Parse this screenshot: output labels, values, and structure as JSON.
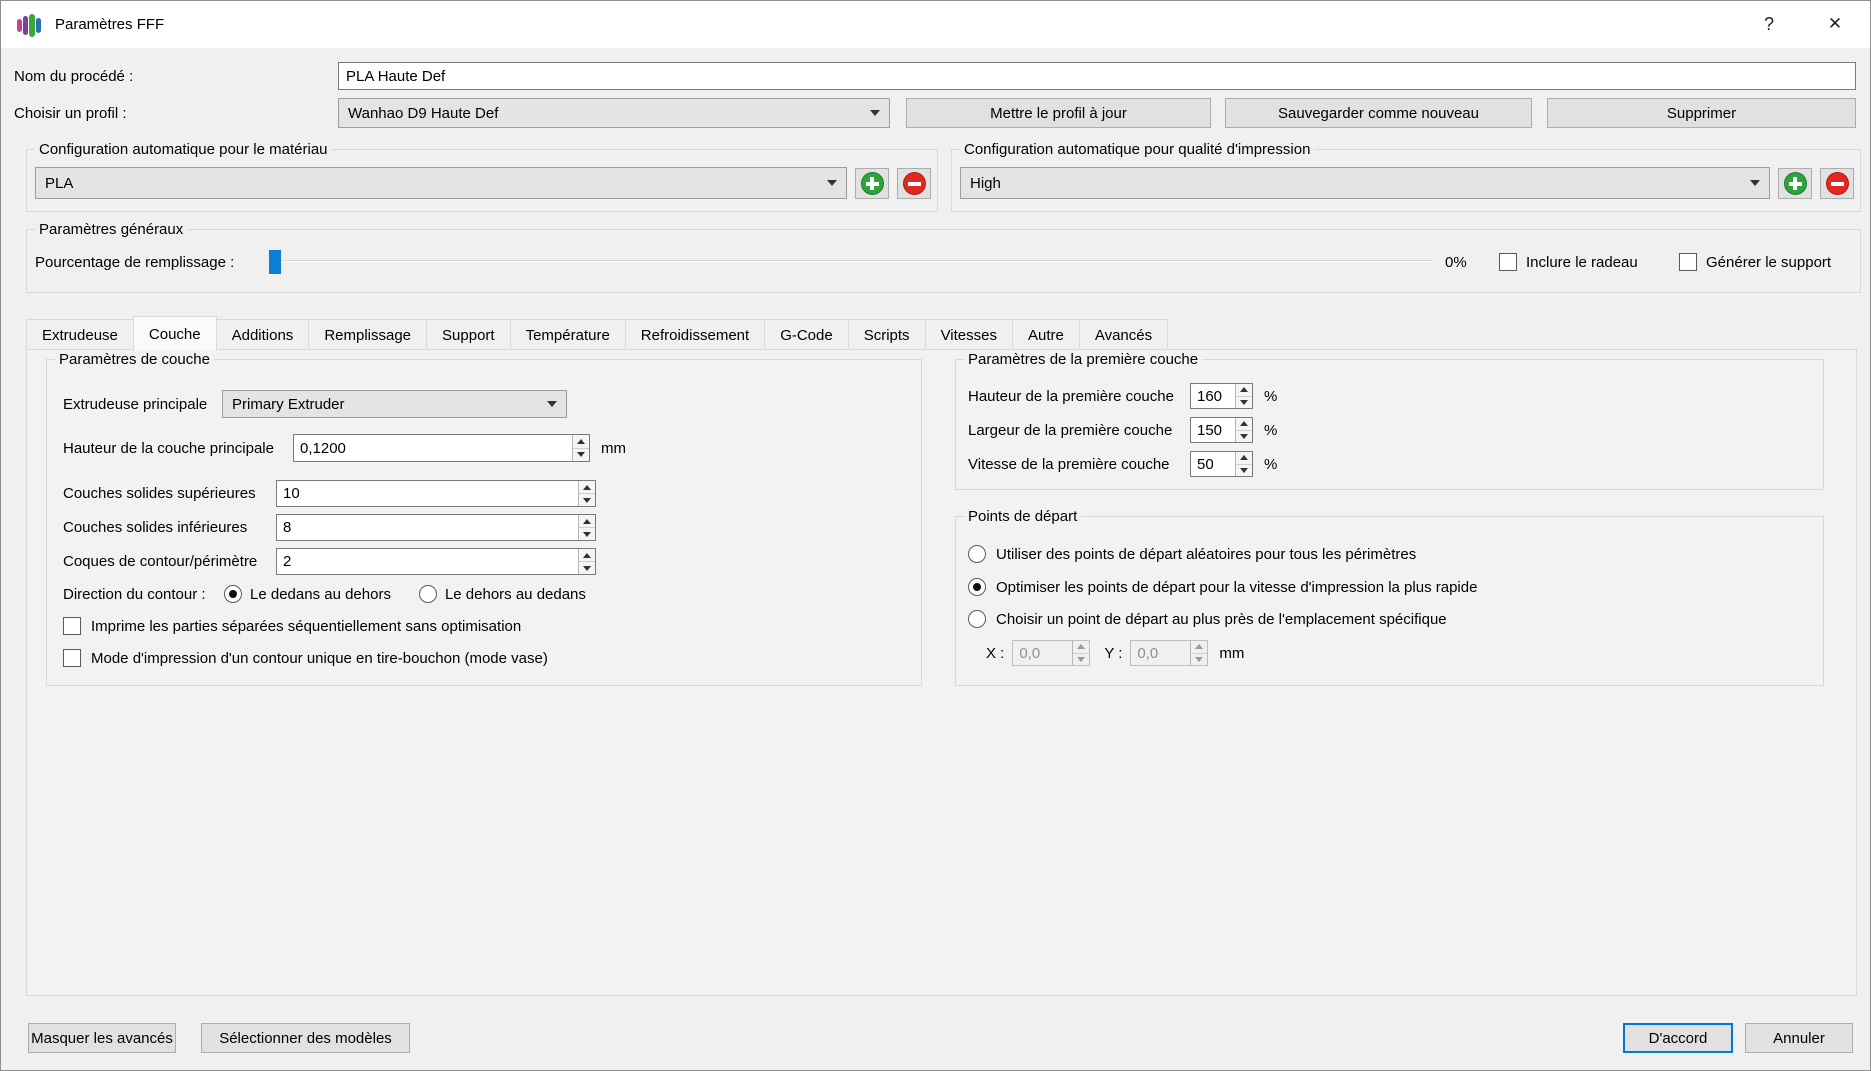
{
  "window": {
    "title": "Paramètres FFF",
    "help": "?",
    "close": "✕"
  },
  "header": {
    "process_name_label": "Nom du procédé :",
    "process_name_value": "PLA Haute Def",
    "profile_label": "Choisir un profil :",
    "profile_value": "Wanhao D9 Haute Def",
    "update_profile_button": "Mettre le profil à jour",
    "save_as_new_button": "Sauvegarder comme nouveau",
    "delete_button": "Supprimer"
  },
  "material_group": {
    "title": "Configuration automatique pour le matériau",
    "value": "PLA"
  },
  "quality_group": {
    "title": "Configuration automatique pour qualité d'impression",
    "value": "High"
  },
  "general": {
    "title": "Paramètres généraux",
    "infill_label": "Pourcentage de remplissage :",
    "infill_value": "0%",
    "raft_checkbox_label": "Inclure le radeau",
    "support_checkbox_label": "Générer le support"
  },
  "tabs": [
    "Extrudeuse",
    "Couche",
    "Additions",
    "Remplissage",
    "Support",
    "Température",
    "Refroidissement",
    "G-Code",
    "Scripts",
    "Vitesses",
    "Autre",
    "Avancés"
  ],
  "active_tab": "Couche",
  "layer": {
    "title": "Paramètres de couche",
    "primary_extruder_label": "Extrudeuse principale",
    "primary_extruder_value": "Primary Extruder",
    "layer_height_label": "Hauteur de la couche principale",
    "layer_height_value": "0,1200",
    "layer_height_unit": "mm",
    "top_layers_label": "Couches solides supérieures",
    "top_layers_value": "10",
    "bottom_layers_label": "Couches solides inférieures",
    "bottom_layers_value": "8",
    "perimeters_label": "Coques de contour/périmètre",
    "perimeters_value": "2",
    "direction_label": "Direction du contour :",
    "direction_inside_out": "Le dedans au dehors",
    "direction_outside_in": "Le dehors au dedans",
    "sequential_checkbox_label": "Imprime les parties séparées séquentiellement sans optimisation",
    "vase_checkbox_label": "Mode d'impression d'un contour unique en tire-bouchon (mode vase)"
  },
  "first_layer": {
    "title": "Paramètres de la première couche",
    "height_label": "Hauteur de la première couche",
    "height_value": "160",
    "width_label": "Largeur de la première couche",
    "width_value": "150",
    "speed_label": "Vitesse de la première couche",
    "speed_value": "50",
    "unit": "%"
  },
  "start_points": {
    "title": "Points de départ",
    "random_option": "Utiliser des points de départ aléatoires pour tous les périmètres",
    "optimize_option": "Optimiser les points de départ pour la vitesse d'impression la plus rapide",
    "closest_option": "Choisir un point de départ au plus près de l'emplacement spécifique",
    "x_label": "X :",
    "x_value": "0,0",
    "y_label": "Y :",
    "y_value": "0,0",
    "unit": "mm"
  },
  "footer": {
    "hide_advanced_button": "Masquer les avancés",
    "select_models_button": "Sélectionner des modèles",
    "ok_button": "D'accord",
    "cancel_button": "Annuler"
  },
  "colors": {
    "accent_blue": "#0078d7",
    "slider_handle": "#0d7dd6",
    "add_green": "#2ea43c",
    "remove_red": "#e02920"
  }
}
